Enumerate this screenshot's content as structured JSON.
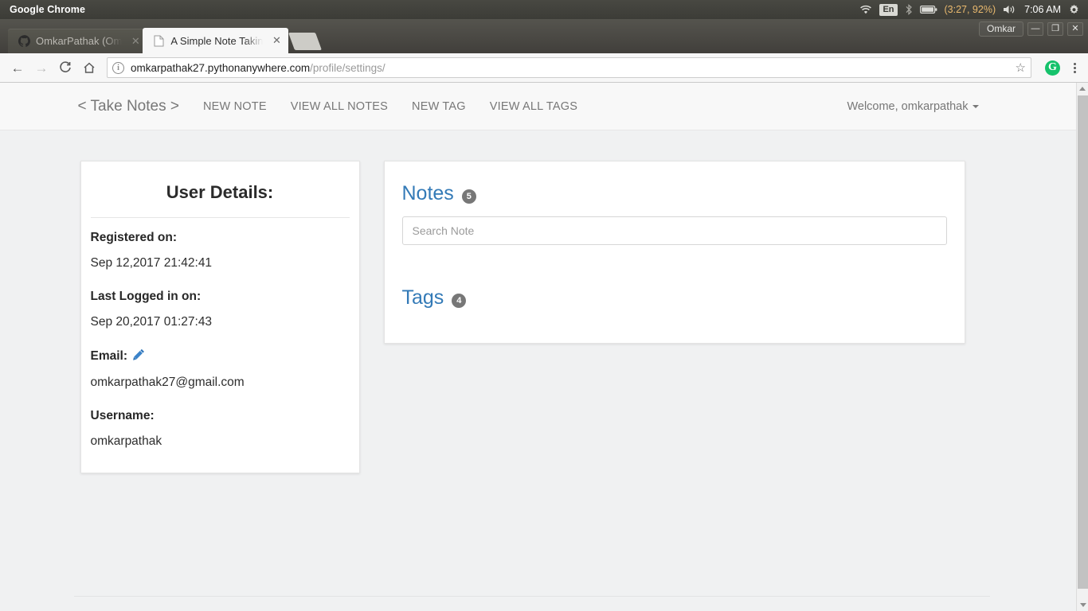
{
  "desktop": {
    "app_name": "Google Chrome",
    "tray": {
      "wifi_icon": "wifi-icon",
      "keyboard_layout": "En",
      "bluetooth_icon": "bluetooth-icon",
      "battery_icon": "battery-icon",
      "battery_status": "(3:27, 92%)",
      "volume_icon": "volume-icon",
      "clock": "7:06 AM",
      "settings_icon": "gear-icon"
    }
  },
  "browser": {
    "window_user": "Omkar",
    "window_controls": {
      "minimize": "—",
      "maximize": "❐",
      "close": "✕"
    },
    "tabs": [
      {
        "title": "OmkarPathak (Om",
        "favicon": "github-icon",
        "active": false,
        "close": "✕"
      },
      {
        "title": "A Simple Note Takin",
        "favicon": "page-icon",
        "active": true,
        "close": "✕"
      }
    ],
    "toolbar": {
      "back_icon": "←",
      "forward_icon": "→",
      "reload_icon": "C",
      "home_icon": "⌂",
      "site_info_icon": "i",
      "url_host": "omkarpathak27.pythonanywhere.com",
      "url_path": "/profile/settings/",
      "bookmark_icon": "☆",
      "extension_icon_label": "G",
      "extension_icon_color": "#15c26b",
      "menu_icon": "kebab-menu-icon"
    }
  },
  "site": {
    "navbar": {
      "brand": "< Take Notes >",
      "links": [
        {
          "label": "NEW NOTE"
        },
        {
          "label": "VIEW ALL NOTES"
        },
        {
          "label": "NEW TAG"
        },
        {
          "label": "VIEW ALL TAGS"
        }
      ],
      "user_menu": "Welcome, omkarpathak"
    },
    "user_card": {
      "title": "User Details:",
      "fields": [
        {
          "label": "Registered on:",
          "value": "Sep 12,2017 21:42:41",
          "editable": false
        },
        {
          "label": "Last Logged in on:",
          "value": "Sep 20,2017 01:27:43",
          "editable": false
        },
        {
          "label": "Email:",
          "value": "omkarpathak27@gmail.com",
          "editable": true
        },
        {
          "label": "Username:",
          "value": "omkarpathak",
          "editable": false
        }
      ]
    },
    "stats_card": {
      "notes": {
        "title": "Notes",
        "count": "5"
      },
      "search": {
        "placeholder": "Search Note",
        "value": ""
      },
      "tags": {
        "title": "Tags",
        "count": "4"
      }
    },
    "colors": {
      "link_blue": "#337ab7",
      "badge_gray": "#777777",
      "page_bg": "#f0f1f2",
      "navbar_bg": "#f8f8f8"
    }
  }
}
